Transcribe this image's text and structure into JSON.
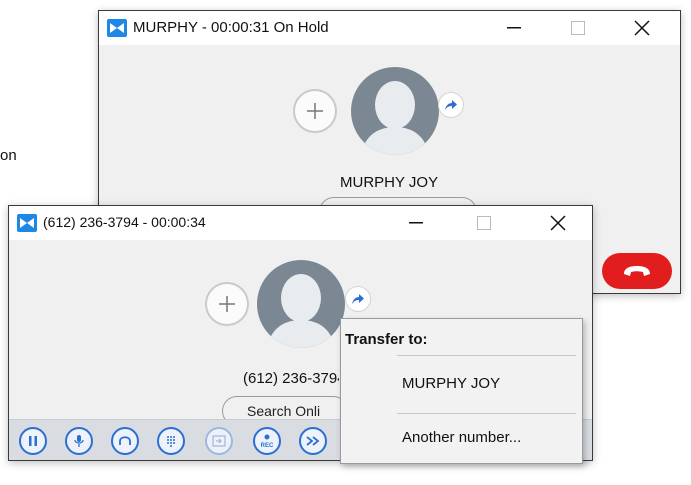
{
  "background": {
    "partial_text": "on"
  },
  "window_back": {
    "title": "MURPHY - 00:00:31 On Hold",
    "contact_name": "MURPHY JOY"
  },
  "window_front": {
    "title": "(612) 236-3794 - 00:00:34",
    "contact_number": "(612) 236-3794",
    "search_label": "Search Onli",
    "rec_label": "REC"
  },
  "transfer_menu": {
    "header": "Transfer to:",
    "items": [
      "MURPHY JOY",
      "Another number..."
    ]
  },
  "colors": {
    "accent": "#2c6fd2",
    "hangup": "#e21d1d",
    "toolbar": "#d9dde2"
  },
  "icons": [
    "app-logo-icon",
    "minimize-icon",
    "maximize-icon",
    "close-icon",
    "add-call-icon",
    "contact-avatar-icon",
    "transfer-icon",
    "pause-icon",
    "microphone-icon",
    "headset-icon",
    "keypad-icon",
    "park-icon",
    "record-icon",
    "transfer-arrow-icon",
    "hangup-icon"
  ]
}
